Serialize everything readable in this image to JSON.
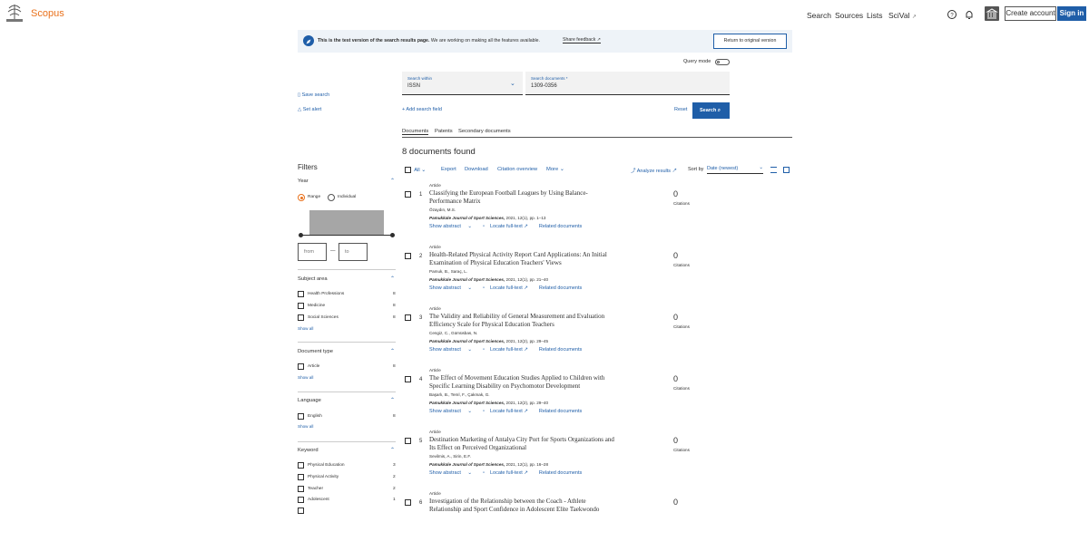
{
  "header": {
    "brand": "Scopus",
    "nav": {
      "search": "Search",
      "sources": "Sources",
      "lists": "Lists",
      "scival": "SciVal",
      "scival_ext": "↗"
    },
    "create_account": "Create account",
    "sign_in": "Sign in",
    "accent": "#e9711c",
    "primary": "#1f5ea8"
  },
  "banner": {
    "bold": "This is the test version of the search results page.",
    "text": "We are working on making all the features available.",
    "share_feedback": "Share feedback ↗",
    "return": "Return to original version"
  },
  "query_mode": "Query mode",
  "search": {
    "within_label": "Search within",
    "within_value": "ISSN",
    "docs_label": "Search documents *",
    "docs_value": "1309-0356",
    "add_field": "+ Add search field",
    "reset": "Reset",
    "search_btn": "Search"
  },
  "side": {
    "save_search": "Save search",
    "set_alert": "Set alert"
  },
  "tabs": {
    "documents": "Documents",
    "patents": "Patents",
    "secondary": "Secondary documents"
  },
  "results_found": "8 documents found",
  "toolbar": {
    "all": "All",
    "export": "Export",
    "download": "Download",
    "citation_overview": "Citation overview",
    "more": "More",
    "analyze": "Analyze results ↗",
    "sort_by": "Sort by",
    "sort_value": "Date (newest)"
  },
  "filters": {
    "title": "Filters",
    "year": {
      "title": "Year",
      "range": "Range",
      "individual": "Individual",
      "from": "from",
      "to": "to",
      "dash": "—"
    },
    "subject_area": {
      "title": "Subject area",
      "items": [
        {
          "label": "Health Professions",
          "count": "8"
        },
        {
          "label": "Medicine",
          "count": "8"
        },
        {
          "label": "Social Sciences",
          "count": "8"
        }
      ],
      "show_all": "Show all"
    },
    "document_type": {
      "title": "Document type",
      "items": [
        {
          "label": "Article",
          "count": "8"
        }
      ],
      "show_all": "Show all"
    },
    "language": {
      "title": "Language",
      "items": [
        {
          "label": "English",
          "count": "8"
        }
      ],
      "show_all": "Show all"
    },
    "keyword": {
      "title": "Keyword",
      "items": [
        {
          "label": "Physical Education",
          "count": "3"
        },
        {
          "label": "Physical Activity",
          "count": "2"
        },
        {
          "label": "Teacher",
          "count": "2"
        },
        {
          "label": "Adolescent",
          "count": "1"
        }
      ]
    }
  },
  "results": [
    {
      "num": "1",
      "type": "Article",
      "title": "Classifying the European Football Leagues by Using Balance-Performance Matrix",
      "authors": "Özaydın, M.S.",
      "journal": "Pamukkale Journal of Sport Sciences,",
      "meta": "2021, 12(1), pp. 1–13",
      "citations": "0"
    },
    {
      "num": "2",
      "type": "Article",
      "title": "Health-Related Physical Activity Report Card Applications: An Initial Examination of Physical Education Teachers' Views",
      "authors": "Pamuk, B., Saraç, L.",
      "journal": "Pamukkale Journal of Sport Sciences,",
      "meta": "2021, 12(1), pp. 21–40",
      "citations": "0"
    },
    {
      "num": "3",
      "type": "Article",
      "title": "The Validity and Reliability of General Measurement and Evaluation Efficiency Scale for Physical Education Teachers",
      "authors": "Cengiz, C., Gümüsbas, N.",
      "journal": "Pamukkale Journal of Sport Sciences,",
      "meta": "2021, 12(2), pp. 29–45",
      "citations": "0"
    },
    {
      "num": "4",
      "type": "Article",
      "title": "The Effect of Movement Education Studies Applied to Children with Specific Learning Disability on Psychomotor Development",
      "authors": "Başarlı, B., Temİ, F., Çakmak, G.",
      "journal": "Pamukkale Journal of Sport Sciences,",
      "meta": "2021, 12(2), pp. 29–40",
      "citations": "0"
    },
    {
      "num": "5",
      "type": "Article",
      "title": "Destination Marketing of Antalya City Port for Sports Organizations and Its Effect on Perceived Organizational",
      "authors": "Sevilmis, A., Sirin, E.F.",
      "journal": "Pamukkale Journal of Sport Sciences,",
      "meta": "2021, 12(1), pp. 16–28",
      "citations": "0"
    },
    {
      "num": "6",
      "type": "Article",
      "title": "Investigation of the Relationship between the Coach - Athlete Relationship and Sport Confidence in Adolescent Elite Taekwondo",
      "authors": "",
      "journal": "",
      "meta": "",
      "citations": "0"
    }
  ],
  "result_actions": {
    "show_abstract": "Show abstract",
    "locate": "Locate full-text ↗",
    "related": "Related documents",
    "citations_label": "Citations"
  }
}
